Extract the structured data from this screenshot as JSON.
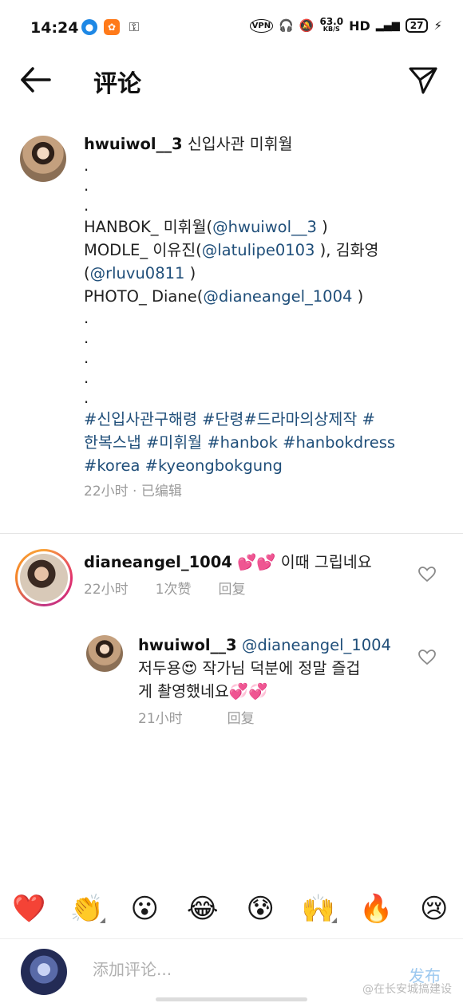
{
  "status_bar": {
    "time": "14:24",
    "net_speed_value": "63.0",
    "net_speed_unit": "KB/S",
    "hd_label": "HD",
    "battery": "27"
  },
  "header": {
    "title": "评论"
  },
  "post": {
    "username": "hwuiwol__3",
    "caption_lines": {
      "l0_text": " 신입사관 미휘월",
      "dot1": ".",
      "dot2": ".",
      "dot3": ".",
      "l1_pre": "HANBOK_ 미휘월(",
      "l1_mention": "@hwuiwol__3",
      "l1_post": " )",
      "l2_pre": "MODLE_ 이유진(",
      "l2_mention": "@latulipe0103",
      "l2_post": " ), 김화영",
      "l3_pre": "(",
      "l3_mention": "@rluvu0811",
      "l3_post": " )",
      "l4_pre": "PHOTO_ Diane(",
      "l4_mention": "@dianeangel_1004",
      "l4_post": " )",
      "dot4": ".",
      "dot5": ".",
      "dot6": ".",
      "dot7": ".",
      "dot8": ".",
      "tags1": "#신입사관구해령 #단령#드라마의상제작  #",
      "tags2": "한복스냅 #미휘월 #hanbok #hanbokdress",
      "tags3": "#korea #kyeongbokgung"
    },
    "meta": "22小时 · 已编辑"
  },
  "comments": [
    {
      "username": "dianeangel_1004",
      "text": " 💕💕 이때 그립네요",
      "time": "22小时",
      "likes": "1次赞",
      "reply": "回复"
    }
  ],
  "reply": {
    "username": "hwuiwol__3",
    "mention": " @dianeangel_1004",
    "line2": "저두용😍 작가님 덕분에 정말 즐겁",
    "line3": "게 촬영했네요💞💞",
    "time": "21小时",
    "reply": "回复"
  },
  "emoji_bar": [
    "❤️",
    "👏",
    "😮",
    "😂",
    "😰",
    "🙌",
    "🔥",
    "😢"
  ],
  "input": {
    "placeholder": "添加评论...",
    "post_label": "发布"
  },
  "watermark": "@在长安城搞建设"
}
